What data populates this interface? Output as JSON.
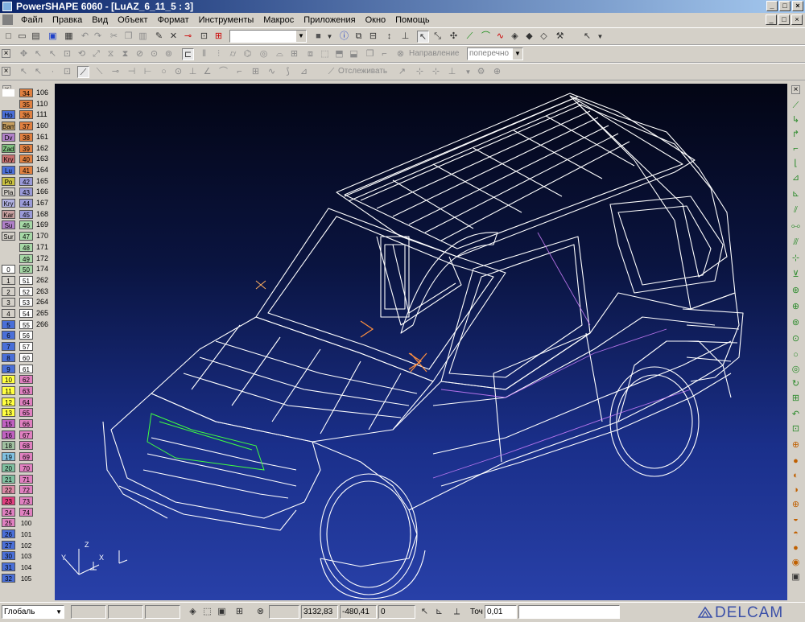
{
  "window": {
    "title": "PowerSHAPE 6060 - [LuAZ_6_11_5 : 3]"
  },
  "menu": [
    "Файл",
    "Правка",
    "Вид",
    "Объект",
    "Формат",
    "Инструменты",
    "Макрос",
    "Приложения",
    "Окно",
    "Помощь"
  ],
  "toolbar2": {
    "direction_label": "Направление",
    "direction_value": "поперечно"
  },
  "toolbar3": {
    "follow_label": "Отслеживать"
  },
  "levels_left": [
    {
      "tag": "",
      "num": "34",
      "color": "#e08040"
    },
    {
      "tag": "",
      "num": "35",
      "color": "#e08040"
    },
    {
      "tag": "Ho",
      "num": "36",
      "color": "#e08040"
    },
    {
      "tag": "Bam",
      "num": "37",
      "color": "#e08040"
    },
    {
      "tag": "Dv",
      "num": "38",
      "color": "#e08040"
    },
    {
      "tag": "Zad",
      "num": "39",
      "color": "#e08040"
    },
    {
      "tag": "Kry",
      "num": "40",
      "color": "#e08040"
    },
    {
      "tag": "Lu",
      "num": "41",
      "color": "#e08040"
    },
    {
      "tag": "Po",
      "num": "42",
      "color": "#9a9ad8"
    },
    {
      "tag": "Pla",
      "num": "43",
      "color": "#9a9ad8"
    },
    {
      "tag": "Kry",
      "num": "44",
      "color": "#9a9ad8"
    },
    {
      "tag": "Kar",
      "num": "45",
      "color": "#9a9ad8"
    },
    {
      "tag": "Su",
      "num": "46",
      "color": "#a6d8a6"
    },
    {
      "tag": "Sur",
      "num": "47",
      "color": "#a6d8a6"
    },
    {
      "tag": "",
      "num": "48",
      "color": "#a6d8a6"
    },
    {
      "tag": "",
      "num": "49",
      "color": "#a6d8a6"
    },
    {
      "tag": "0",
      "num": "50",
      "color": "#a6d8a6"
    },
    {
      "tag": "1",
      "num": "51",
      "color": "#ffffff"
    },
    {
      "tag": "2",
      "num": "52",
      "color": "#ffffff"
    },
    {
      "tag": "3",
      "num": "53",
      "color": "#ffffff"
    },
    {
      "tag": "4",
      "num": "54",
      "color": "#ffffff"
    },
    {
      "tag": "5",
      "num": "55",
      "color": "#ffffff"
    },
    {
      "tag": "6",
      "num": "56",
      "color": "#ffffff"
    },
    {
      "tag": "7",
      "num": "57",
      "color": "#ffffff"
    },
    {
      "tag": "8",
      "num": "60",
      "color": "#ffffff"
    },
    {
      "tag": "9",
      "num": "61",
      "color": "#ffffff"
    },
    {
      "tag": "10",
      "num": "62",
      "color": "#e080c0"
    },
    {
      "tag": "11",
      "num": "63",
      "color": "#e080c0"
    },
    {
      "tag": "12",
      "num": "64",
      "color": "#e080c0"
    },
    {
      "tag": "13",
      "num": "65",
      "color": "#e080c0"
    },
    {
      "tag": "15",
      "num": "66",
      "color": "#e080c0"
    },
    {
      "tag": "16",
      "num": "67",
      "color": "#e080c0"
    },
    {
      "tag": "18",
      "num": "68",
      "color": "#e080c0"
    },
    {
      "tag": "19",
      "num": "69",
      "color": "#e080c0"
    },
    {
      "tag": "20",
      "num": "70",
      "color": "#e080c0"
    },
    {
      "tag": "21",
      "num": "71",
      "color": "#e080c0"
    },
    {
      "tag": "22",
      "num": "72",
      "color": "#e080c0"
    },
    {
      "tag": "23",
      "num": "73",
      "color": "#e080c0"
    },
    {
      "tag": "24",
      "num": "74",
      "color": "#e080c0"
    },
    {
      "tag": "25",
      "num": "100",
      "color": ""
    },
    {
      "tag": "26",
      "num": "101",
      "color": ""
    },
    {
      "tag": "27",
      "num": "102",
      "color": ""
    },
    {
      "tag": "30",
      "num": "103",
      "color": ""
    },
    {
      "tag": "31",
      "num": "104",
      "color": ""
    },
    {
      "tag": "32",
      "num": "105",
      "color": ""
    }
  ],
  "levels_tag_colors": [
    "#ffffff",
    "#d4d0c8",
    "#4a6fd8",
    "#c8a060",
    "#b080c8",
    "#80c080",
    "#c87070",
    "#4a6fd8",
    "#c8c040",
    "#d4d0c8",
    "#b0b0e0",
    "#c8a0a0",
    "#b080c8",
    "#d4d0c8",
    "#d4d0c8",
    "#d4d0c8",
    "#ffffff",
    "#d4d0c8",
    "#d4d0c8",
    "#d4d0c8",
    "#d4d0c8",
    "#4a6fd8",
    "#4a6fd8",
    "#4a6fd8",
    "#4a6fd8",
    "#4a6fd8",
    "#ffff40",
    "#ffff40",
    "#ffff40",
    "#ffff40",
    "#c060c0",
    "#c060c0",
    "#a0c0a0",
    "#80c0e0",
    "#80c0a0",
    "#80c0a0",
    "#e0408080",
    "#e04080",
    "#e080c0",
    "#e080c0",
    "#4a6fd8",
    "#4a6fd8",
    "#4a6fd8",
    "#4a6fd8",
    "#4a6fd8"
  ],
  "levels_right": [
    "106",
    "110",
    "111",
    "160",
    "161",
    "162",
    "163",
    "164",
    "165",
    "166",
    "167",
    "168",
    "169",
    "170",
    "171",
    "172",
    "174",
    "262",
    "263",
    "264",
    "265",
    "266"
  ],
  "axis": {
    "z": "Z",
    "y": "Y",
    "x": "X"
  },
  "status": {
    "workplane": "Глобаль",
    "x": "3132,83",
    "y": "-480,41",
    "z": "0",
    "tol_label": "Точ",
    "tol_value": "0,01",
    "brand": "DELCAM"
  },
  "colors": {
    "viewport_top": "#030514",
    "viewport_bottom": "#2840a8",
    "wire": "#ffffff",
    "title_left": "#0a246a"
  }
}
